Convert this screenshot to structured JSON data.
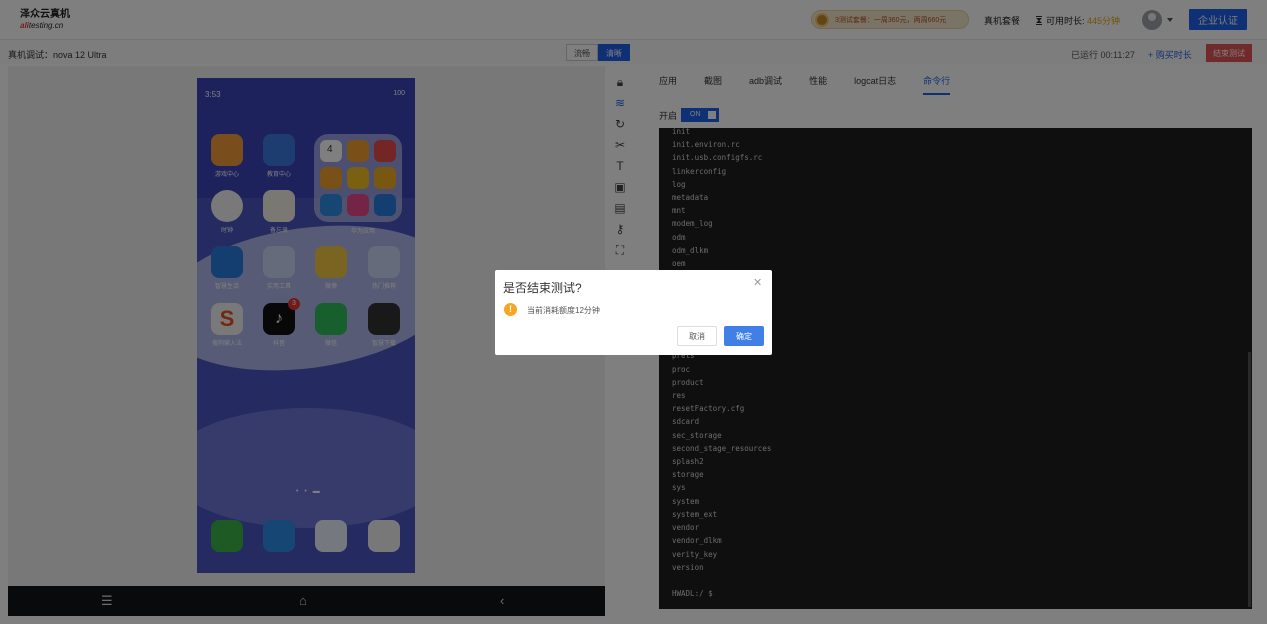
{
  "header": {
    "logo_line1": "泽众云真机",
    "logo_prefix": "ali",
    "logo_line2": "testing.cn",
    "promo": "3测试套餐：一周360元，两周660元",
    "nav_package": "真机套餐",
    "remaining_label": "可用时长:",
    "remaining_value": "445分钟",
    "cert_button": "企业认证"
  },
  "subbar": {
    "device": "真机调试：nova 12 Ultra",
    "quality": [
      "流畅",
      "清晰"
    ],
    "runtime": "已运行 00:11:27",
    "buy": "+ 购买时长",
    "end_button": "结束测试"
  },
  "phone": {
    "time": "3:53",
    "status_right": "100",
    "apps": [
      {
        "label": "游戏中心",
        "color": "#f29a38"
      },
      {
        "label": "教育中心",
        "color": "#3a7ae0"
      },
      {
        "label": "时钟",
        "color": "#f2f2f2"
      },
      {
        "label": "备忘录",
        "color": "#f5f1e6"
      },
      {
        "label": "华为应用",
        "color": "#cdd6f7"
      },
      {
        "label": "智慧生活",
        "color": "#2a7de1"
      },
      {
        "label": "实用工具",
        "color": "#cdd6f7"
      },
      {
        "label": "微博",
        "color": "#f5c842"
      },
      {
        "label": "热门推荐",
        "color": "#cdd6f7"
      },
      {
        "label": "搜狗输入法",
        "color": "#f2f2f2"
      },
      {
        "label": "抖音",
        "color": "#111111"
      },
      {
        "label": "微信",
        "color": "#2ec15c"
      },
      {
        "label": "智慧下载",
        "color": "#333333"
      }
    ],
    "tiktok_badge": "3",
    "clock_number": "4",
    "dock": [
      {
        "name": "phone",
        "color": "#3cb548"
      },
      {
        "name": "messages",
        "color": "#2a8de8"
      },
      {
        "name": "browser",
        "color": "#eaf1ff"
      },
      {
        "name": "camera",
        "color": "#f1f1f1"
      }
    ],
    "page_dots": "• • ▬"
  },
  "tools": [
    "lock-icon",
    "wifi-icon",
    "rotate-icon",
    "scissors-icon",
    "text-icon",
    "image-add-icon",
    "image-upload-icon",
    "key-icon",
    "fullscreen-icon"
  ],
  "tabs": [
    "应用",
    "截图",
    "adb调试",
    "性能",
    "logcat日志",
    "命令行"
  ],
  "switch": {
    "label": "开启",
    "value": "ON"
  },
  "terminal": {
    "lines": [
      "init",
      "init.environ.rc",
      "init.usb.configfs.rc",
      "linkerconfig",
      "log",
      "metadata",
      "mnt",
      "modem_log",
      "odm",
      "odm_dlkm",
      "oem",
      "",
      "",
      "",
      "",
      "",
      "",
      "prets",
      "proc",
      "product",
      "res",
      "resetFactory.cfg",
      "sdcard",
      "sec_storage",
      "second_stage_resources",
      "splash2",
      "storage",
      "sys",
      "system",
      "system_ext",
      "vendor",
      "vendor_dlkm",
      "verity_key",
      "version",
      "",
      "HWADL:/ $"
    ]
  },
  "dialog": {
    "title": "是否结束测试?",
    "message": "当前消耗额度12分钟",
    "cancel": "取消",
    "confirm": "确定"
  }
}
